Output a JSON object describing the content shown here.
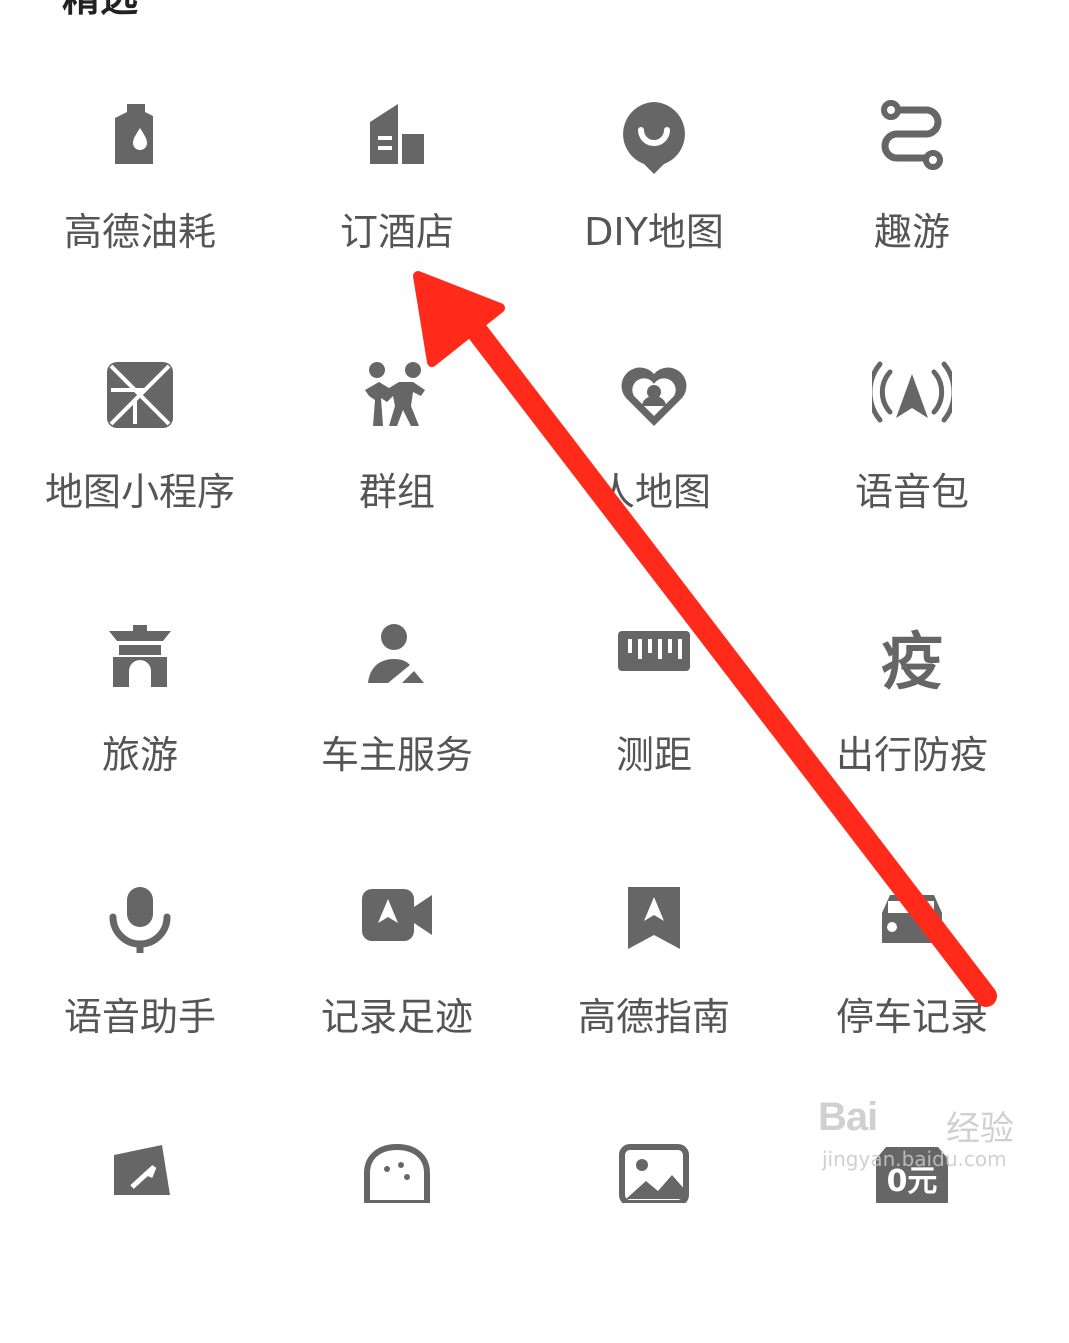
{
  "section": {
    "title": "精选"
  },
  "items": [
    {
      "label": "高德油耗",
      "icon": "fuel-can-icon"
    },
    {
      "label": "订酒店",
      "icon": "hotel-building-icon"
    },
    {
      "label": "DIY地图",
      "icon": "diy-map-pin-icon"
    },
    {
      "label": "趣游",
      "icon": "route-path-icon"
    },
    {
      "label": "地图小程序",
      "icon": "mini-program-icon"
    },
    {
      "label": "群组",
      "icon": "group-people-icon"
    },
    {
      "label": "人地图",
      "icon": "heart-person-icon"
    },
    {
      "label": "语音包",
      "icon": "voice-broadcast-icon"
    },
    {
      "label": "旅游",
      "icon": "pavilion-icon"
    },
    {
      "label": "车主服务",
      "icon": "car-owner-icon"
    },
    {
      "label": "测距",
      "icon": "ruler-icon"
    },
    {
      "label": "出行防疫",
      "icon": "epidemic-character-icon"
    },
    {
      "label": "语音助手",
      "icon": "microphone-icon"
    },
    {
      "label": "记录足迹",
      "icon": "video-camera-icon"
    },
    {
      "label": "高德指南",
      "icon": "bookmark-guide-icon"
    },
    {
      "label": "停车记录",
      "icon": "parking-car-icon"
    },
    {
      "label": "",
      "icon": "share-card-icon"
    },
    {
      "label": "",
      "icon": "face-icon"
    },
    {
      "label": "",
      "icon": "picture-icon"
    },
    {
      "label": "",
      "icon": "zero-yuan-tag-icon"
    }
  ],
  "overlay": {
    "arrow_color": "#ff2a1a"
  },
  "watermark": {
    "brand": "Bai",
    "brand2": "经验",
    "url": "jingyan.baidu.com"
  },
  "colors": {
    "icon": "#666666",
    "label": "#555555"
  }
}
